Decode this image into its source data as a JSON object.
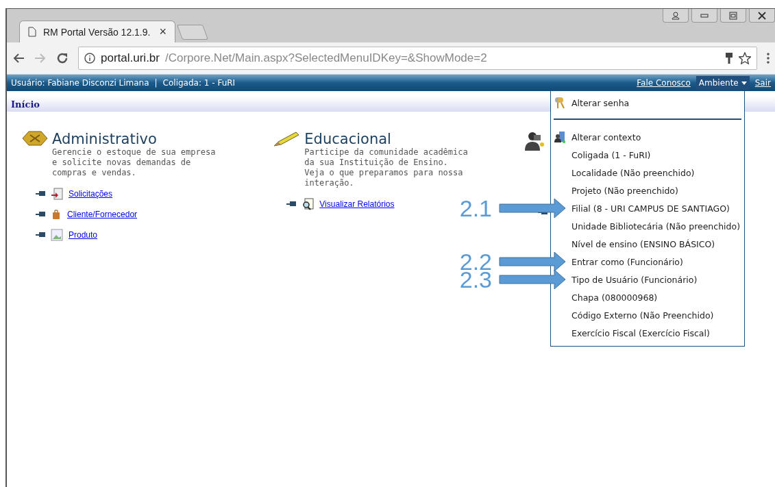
{
  "browser": {
    "tab": {
      "title": "RM Portal Versão 12.1.9.",
      "close": "×"
    },
    "address": {
      "host": "portal.uri.br",
      "path": "/Corpore.Net/Main.aspx?SelectedMenuIDKey=&ShowMode=2"
    }
  },
  "header": {
    "user": "Usuário: Fabiane Disconzi Limana",
    "separator": "|",
    "company": "Coligada: 1 - FuRI",
    "links": [
      {
        "label": "Fale Conosco",
        "kind": "link"
      },
      {
        "label": "Ambiente",
        "kind": "menu",
        "expanded": true
      },
      {
        "label": "Sair",
        "kind": "link"
      }
    ]
  },
  "breadcrumb": "Início",
  "modules": [
    {
      "title": "Administrativo",
      "kind": "admin",
      "description": "Gerencie o estoque de sua empresa e solicite novas demandas de compras e vendas.",
      "links": [
        {
          "label": "Solicitações",
          "kind": "request"
        },
        {
          "label": "Cliente/Fornecedor",
          "kind": "bag"
        },
        {
          "label": "Produto",
          "kind": "image"
        }
      ]
    },
    {
      "title": "Educacional",
      "kind": "pencil",
      "description": "Participe da comunidade acadêmica da sua Instituição de Ensino. Veja o que preparamos para nossa interação.",
      "links": [
        {
          "label": "Visualizar Relatórios",
          "kind": "report"
        }
      ]
    },
    {
      "kind": "person",
      "links": [
        {
          "kind": "hidden"
        }
      ]
    }
  ],
  "menu": {
    "sections": [
      {
        "items": [
          {
            "label": "Alterar senha",
            "kind": "keys"
          }
        ]
      },
      {
        "items": [
          {
            "label": "Alterar contexto",
            "kind": "context"
          },
          {
            "label": "Coligada (1 - FuRI)",
            "kind": "option"
          },
          {
            "label": "Localidade (Não preenchido)",
            "kind": "option"
          },
          {
            "label": "Projeto (Não preenchido)",
            "kind": "option"
          },
          {
            "label": "Filial (8 - URI CAMPUS DE SANTIAGO)",
            "kind": "option",
            "annotation": "2.1"
          },
          {
            "label": "Unidade Bibliotecária (Não preenchido)",
            "kind": "option"
          },
          {
            "label": "Nível de ensino (ENSINO BÁSICO)",
            "kind": "option"
          },
          {
            "label": "Entrar como (Funcionário)",
            "kind": "option",
            "annotation": "2.2"
          },
          {
            "label": "Tipo de Usuário (Funcionário)",
            "kind": "option",
            "annotation": "2.3"
          },
          {
            "label": "Chapa (080000968)",
            "kind": "option"
          },
          {
            "label": "Código Externo (Não Preenchido)",
            "kind": "option"
          },
          {
            "label": "Exercício Fiscal (Exercício Fiscal)",
            "kind": "option"
          }
        ]
      }
    ]
  }
}
